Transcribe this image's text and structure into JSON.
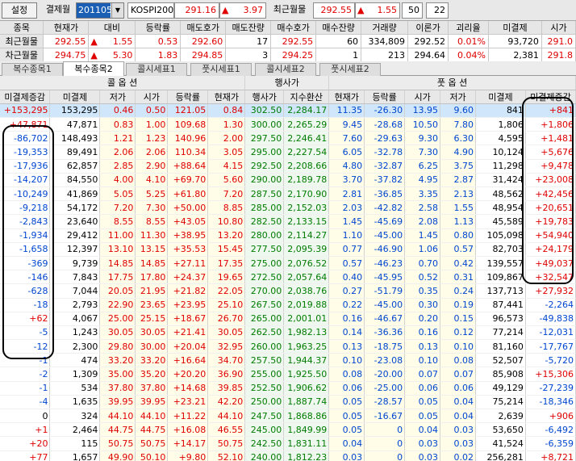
{
  "toolbar": {
    "settings_label": "설정",
    "expiry_label": "결제월",
    "expiry_value": "201105",
    "dropdown_arrow": "▼",
    "index_name": "KOSPI200",
    "index_price": "291.16",
    "index_change_dir": "▲",
    "index_change": "3.97",
    "recent_label": "최근월물",
    "recent_price": "292.55",
    "recent_change_dir": "▲",
    "recent_change": "1.55",
    "count_a": "50",
    "count_b": "22"
  },
  "summary": {
    "headers": [
      "종목",
      "현재가",
      "대비",
      "등락률",
      "매도호가",
      "매도잔량",
      "매수호가",
      "매수잔량",
      "거래량",
      "이론가",
      "괴리율",
      "미결제",
      "시가"
    ],
    "rows": [
      {
        "name": "최근월물",
        "price": "292.55",
        "dir": "▲",
        "chg": "1.55",
        "rate": "0.53",
        "ask": "292.60",
        "askq": "17",
        "bid": "292.55",
        "bidq": "60",
        "vol": "334,809",
        "theo": "292.52",
        "gap": "0.01%",
        "oi": "93,720",
        "open": "291.0"
      },
      {
        "name": "차근월물",
        "price": "294.75",
        "dir": "▲",
        "chg": "5.30",
        "rate": "1.83",
        "ask": "294.85",
        "askq": "3",
        "bid": "294.25",
        "bidq": "1",
        "vol": "213",
        "theo": "294.64",
        "gap": "0.04%",
        "oi": "2,381",
        "open": "291.8"
      }
    ]
  },
  "tabs": [
    "복수종목1",
    "복수종목2",
    "콜시세표1",
    "풋시세표1",
    "콜시세표2",
    "풋시세표2"
  ],
  "active_tab": 1,
  "grid": {
    "group_call": "콜 옵 션",
    "group_strike": "행사가",
    "group_put": "풋 옵 션",
    "headers": [
      "미결제증감",
      "미결제",
      "저가",
      "시가",
      "등락률",
      "현재가",
      "행사가",
      "지수환산",
      "현재가",
      "등락률",
      "시가",
      "저가",
      "미결제",
      "미결제증감"
    ],
    "rows": [
      [
        "+153,295",
        "153,295",
        "0.46",
        "0.50",
        "121.05",
        "0.84",
        "302.50",
        "2,284.17",
        "11.35",
        "-26.30",
        "13.95",
        "9.60",
        "841",
        "+841"
      ],
      [
        "+47,871",
        "47,871",
        "0.83",
        "1.00",
        "109.68",
        "1.30",
        "300.00",
        "2,265.29",
        "9.45",
        "-28.68",
        "10.50",
        "7.80",
        "1,806",
        "+1,806"
      ],
      [
        "-86,702",
        "148,493",
        "1.21",
        "1.23",
        "140.96",
        "2.00",
        "297.50",
        "2,246.41",
        "7.60",
        "-29.63",
        "9.30",
        "6.30",
        "4,595",
        "+1,481"
      ],
      [
        "-19,353",
        "89,491",
        "2.06",
        "2.06",
        "110.34",
        "3.05",
        "295.00",
        "2,227.54",
        "6.05",
        "-32.78",
        "7.30",
        "4.90",
        "10,124",
        "+5,676"
      ],
      [
        "-17,936",
        "62,857",
        "2.85",
        "2.90",
        "+88.64",
        "4.15",
        "292.50",
        "2,208.66",
        "4.80",
        "-32.87",
        "6.25",
        "3.75",
        "11,298",
        "+9,478"
      ],
      [
        "-14,207",
        "84,550",
        "4.00",
        "4.10",
        "+69.70",
        "5.60",
        "290.00",
        "2,189.78",
        "3.70",
        "-37.82",
        "4.95",
        "2.87",
        "31,424",
        "+23,008"
      ],
      [
        "-10,249",
        "41,869",
        "5.05",
        "5.25",
        "+61.80",
        "7.20",
        "287.50",
        "2,170.90",
        "2.81",
        "-36.85",
        "3.35",
        "2.13",
        "48,562",
        "+42,456"
      ],
      [
        "-9,218",
        "54,172",
        "7.20",
        "7.30",
        "+50.00",
        "8.85",
        "285.00",
        "2,152.03",
        "2.03",
        "-42.82",
        "2.58",
        "1.55",
        "48,954",
        "+20,651"
      ],
      [
        "-2,843",
        "23,640",
        "8.55",
        "8.55",
        "+43.05",
        "10.80",
        "282.50",
        "2,133.15",
        "1.45",
        "-45.69",
        "2.08",
        "1.13",
        "45,589",
        "+19,783"
      ],
      [
        "-1,934",
        "29,412",
        "11.00",
        "11.30",
        "+38.95",
        "13.20",
        "280.00",
        "2,114.27",
        "1.10",
        "-45.00",
        "1.45",
        "0.80",
        "105,098",
        "+54,940"
      ],
      [
        "-1,658",
        "12,397",
        "13.10",
        "13.15",
        "+35.53",
        "15.45",
        "277.50",
        "2,095.39",
        "0.77",
        "-46.90",
        "1.06",
        "0.57",
        "82,703",
        "+24,179"
      ],
      [
        "-369",
        "9,739",
        "14.85",
        "14.85",
        "+27.11",
        "17.35",
        "275.00",
        "2,076.52",
        "0.57",
        "-46.23",
        "0.70",
        "0.42",
        "139,557",
        "+49,037"
      ],
      [
        "-146",
        "7,843",
        "17.75",
        "17.80",
        "+24.37",
        "19.65",
        "272.50",
        "2,057.64",
        "0.40",
        "-45.95",
        "0.52",
        "0.31",
        "109,867",
        "+32,547"
      ],
      [
        "-628",
        "7,044",
        "20.05",
        "21.95",
        "+21.82",
        "22.05",
        "270.00",
        "2,038.76",
        "0.27",
        "-51.79",
        "0.35",
        "0.24",
        "137,713",
        "+27,932"
      ],
      [
        "-18",
        "2,793",
        "22.90",
        "23.65",
        "+23.95",
        "25.10",
        "267.50",
        "2,019.88",
        "0.22",
        "-45.00",
        "0.30",
        "0.19",
        "87,441",
        "-2,264"
      ],
      [
        "+62",
        "4,067",
        "25.00",
        "25.15",
        "+18.67",
        "26.70",
        "265.00",
        "2,001.01",
        "0.16",
        "-46.67",
        "0.20",
        "0.15",
        "96,573",
        "-49,838"
      ],
      [
        "-5",
        "1,243",
        "30.05",
        "30.05",
        "+21.41",
        "30.05",
        "262.50",
        "1,982.13",
        "0.14",
        "-36.36",
        "0.16",
        "0.12",
        "77,214",
        "-12,031"
      ],
      [
        "-12",
        "2,300",
        "29.80",
        "30.00",
        "+20.04",
        "32.95",
        "260.00",
        "1,963.25",
        "0.13",
        "-18.75",
        "0.13",
        "0.10",
        "81,160",
        "-17,767"
      ],
      [
        "-1",
        "474",
        "33.20",
        "33.20",
        "+16.64",
        "34.70",
        "257.50",
        "1,944.37",
        "0.10",
        "-23.08",
        "0.10",
        "0.08",
        "52,507",
        "-5,720"
      ],
      [
        "-2",
        "1,309",
        "35.00",
        "35.20",
        "+20.20",
        "36.90",
        "255.00",
        "1,925.50",
        "0.08",
        "-20.00",
        "0.07",
        "0.07",
        "85,908",
        "+15,306"
      ],
      [
        "-1",
        "534",
        "37.80",
        "37.80",
        "+14.68",
        "39.85",
        "252.50",
        "1,906.62",
        "0.06",
        "-25.00",
        "0.06",
        "0.06",
        "49,129",
        "-27,239"
      ],
      [
        "-4",
        "1,635",
        "39.95",
        "39.95",
        "+23.21",
        "42.20",
        "250.00",
        "1,887.74",
        "0.05",
        "-28.57",
        "0.05",
        "0.04",
        "75,214",
        "-18,346"
      ],
      [
        "0",
        "324",
        "44.10",
        "44.10",
        "+11.22",
        "44.10",
        "247.50",
        "1,868.86",
        "0.05",
        "-16.67",
        "0.05",
        "0.04",
        "2,639",
        "+906"
      ],
      [
        "+1",
        "2,464",
        "44.75",
        "44.75",
        "+16.08",
        "46.55",
        "245.00",
        "1,849.99",
        "0.05",
        "0",
        "0.04",
        "0.03",
        "53,650",
        "-6,492"
      ],
      [
        "+20",
        "115",
        "50.75",
        "50.75",
        "+14.17",
        "50.75",
        "242.50",
        "1,831.11",
        "0.04",
        "0",
        "0.03",
        "0.03",
        "41,524",
        "-6,359"
      ],
      [
        "+77",
        "1,657",
        "49.90",
        "50.10",
        "+9.80",
        "52.10",
        "240.00",
        "1,812.23",
        "0.03",
        "0",
        "0.03",
        "0.02",
        "256,281",
        "+8,721"
      ]
    ]
  },
  "colors": {
    "up": "#e00000",
    "down": "#0046d0",
    "strike": "#007b00",
    "header_bg": "#e6e6e6"
  }
}
